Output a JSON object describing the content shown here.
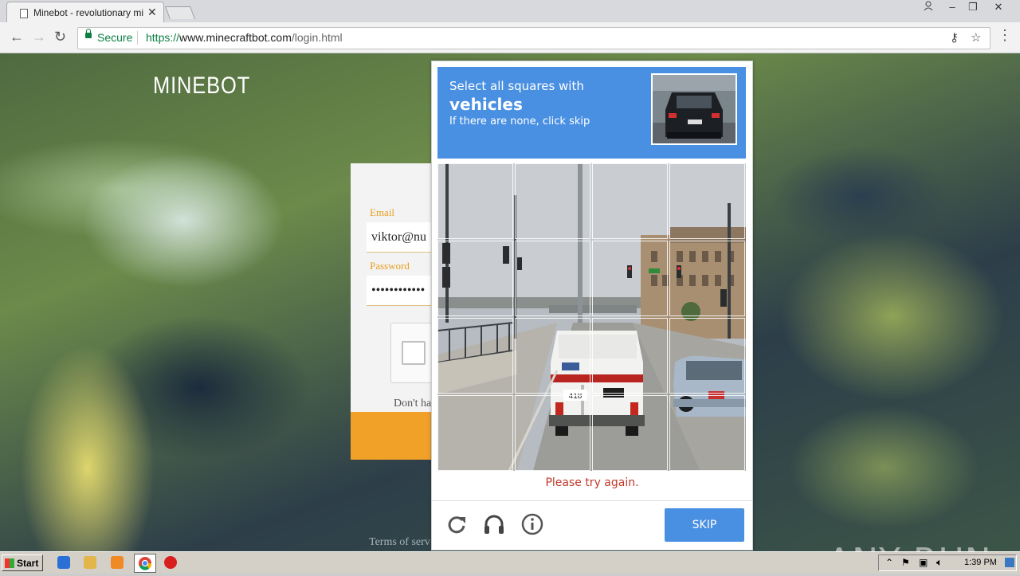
{
  "browser": {
    "tab_title": "Minebot - revolutionary mine",
    "security_label": "Secure",
    "url_scheme": "https://",
    "url_host": "www.minecraftbot.com",
    "url_path": "/login.html"
  },
  "page": {
    "brand": "MINEBOT",
    "email_label": "Email",
    "email_value": "viktor@nu",
    "password_label": "Password",
    "password_value": "••••••••••••",
    "signup_text": "Don't ha",
    "terms_text": "Terms of serv"
  },
  "captcha": {
    "instruction_line1": "Select all squares with",
    "instruction_target": "vehicles",
    "instruction_line3": "If there are none, click skip",
    "error_text": "Please try again.",
    "skip_label": "SKIP",
    "vehicle_number": "418",
    "grid_rows": 4,
    "grid_cols": 4
  },
  "watermark": "ANY RUN",
  "taskbar": {
    "start_label": "Start",
    "clock": "1:39 PM"
  },
  "colors": {
    "captcha_blue": "#4a90e2",
    "accent_orange": "#f1a128",
    "error_red": "#c0392b",
    "secure_green": "#0b8043"
  }
}
